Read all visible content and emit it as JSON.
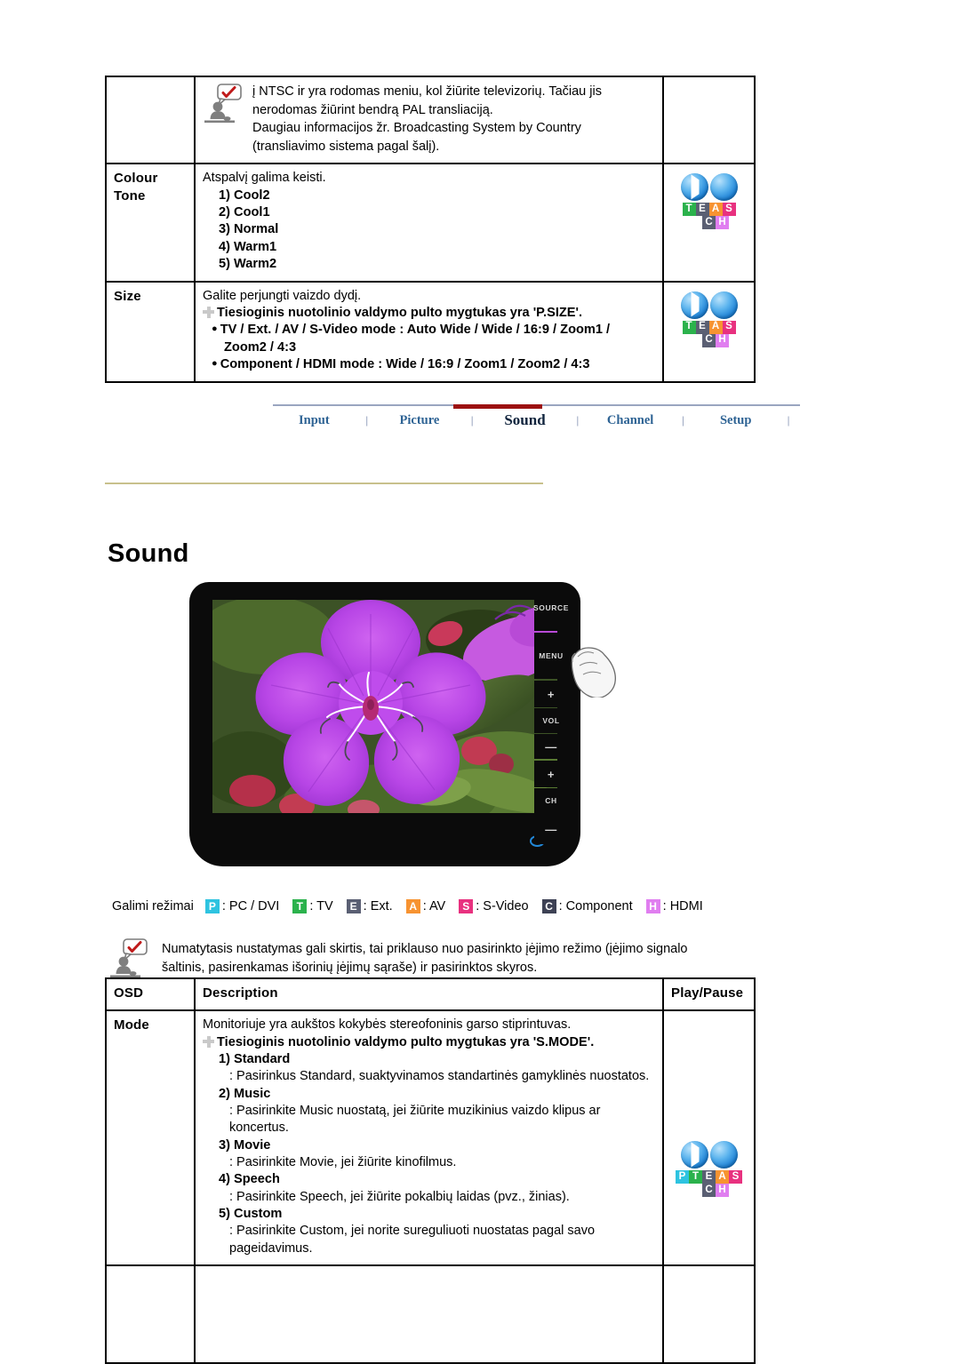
{
  "top_table": {
    "rows": [
      {
        "osd": "",
        "notice": {
          "icon": "notice-person-check-icon",
          "lines": [
            "į NTSC ir yra rodomas meniu, kol žiūrite televizorių. Tačiau jis",
            "nerodomas žiūrint bendrą PAL transliaciją.",
            "Daugiau informacijos žr. Broadcasting System by Country",
            "(transliavimo sistema pagal šalį)."
          ]
        },
        "icons": []
      },
      {
        "osd_lines": [
          "Colour",
          "Tone"
        ],
        "lead": "Atspalvį galima keisti.",
        "options": [
          "1) Cool2",
          "2) Cool1",
          "3) Normal",
          "4) Warm1",
          "5) Warm2"
        ],
        "icon_letters_row1": [
          "T",
          "E",
          "A",
          "S"
        ],
        "icon_letters_row2": [
          "C",
          "H"
        ]
      },
      {
        "osd_lines": [
          "Size"
        ],
        "lead": "Galite perjungti vaizdo dydį.",
        "direct_button": "Tiesioginis nuotolinio valdymo pulto mygtukas yra 'P.SIZE'.",
        "bullets": [
          "TV / Ext. / AV / S-Video mode : Auto Wide / Wide / 16:9 / Zoom1 / Zoom2 / 4:3",
          "Component / HDMI mode : Wide / 16:9 / Zoom1 / Zoom2 / 4:3"
        ],
        "icon_letters_row1": [
          "T",
          "E",
          "A",
          "S"
        ],
        "icon_letters_row2": [
          "C",
          "H"
        ]
      }
    ]
  },
  "nav": {
    "tabs": [
      {
        "label": "Input",
        "active": false
      },
      {
        "label": "Picture",
        "active": false
      },
      {
        "label": "Sound",
        "active": true
      },
      {
        "label": "Channel",
        "active": false
      },
      {
        "label": "Setup",
        "active": false
      }
    ],
    "separator": "|",
    "active_color": "#9c1212",
    "link_color": "#2e6394"
  },
  "page_title": "Sound",
  "tv": {
    "panel_buttons": [
      "SOURCE",
      "MENU",
      "+",
      "VOL",
      "—",
      "+",
      "CH",
      "—"
    ],
    "led_name": "power-led-indicator",
    "screen_content": "purple-tibouchina-flower-photo"
  },
  "legend": {
    "lead": "Galimi režimai",
    "items": [
      {
        "letter": "P",
        "label": ": PC / DVI",
        "color": "#2ec3e0"
      },
      {
        "letter": "T",
        "label": ": TV",
        "color": "#2bb24c"
      },
      {
        "letter": "E",
        "label": ": Ext.",
        "color": "#5a5f73"
      },
      {
        "letter": "A",
        "label": ": AV",
        "color": "#f79331"
      },
      {
        "letter": "S",
        "label": ": S-Video",
        "color": "#e8317f"
      },
      {
        "letter": "C",
        "label": ": Component",
        "color": "#3d4154"
      },
      {
        "letter": "H",
        "label": ": HDMI",
        "color": "#e07ef0"
      }
    ]
  },
  "mid_notice": {
    "icon": "notice-person-check-icon",
    "line1": "Numatytasis nustatymas gali skirtis, tai priklauso nuo pasirinkto įėjimo režimo (įėjimo signalo",
    "line2": "šaltinis, pasirenkamas išorinių įėjimų sąraše) ir pasirinktos skyros."
  },
  "osd_table": {
    "headers": {
      "osd": "OSD",
      "description": "Description",
      "play_pause": "Play/Pause"
    },
    "mode_row": {
      "osd": "Mode",
      "lead": "Monitoriuje yra aukštos kokybės stereofoninis garso stiprintuvas.",
      "direct_button": "Tiesioginis nuotolinio valdymo pulto mygtukas yra 'S.MODE'.",
      "options": [
        {
          "title": "1) Standard",
          "desc": ": Pasirinkus Standard, suaktyvinamos standartinės gamyklinės nuostatos."
        },
        {
          "title": "2) Music",
          "desc": ": Pasirinkite Music nuostatą, jei žiūrite muzikinius vaizdo klipus ar koncertus."
        },
        {
          "title": "3) Movie",
          "desc": ": Pasirinkite Movie, jei žiūrite kinofilmus."
        },
        {
          "title": "4) Speech",
          "desc": ": Pasirinkite Speech, jei žiūrite pokalbių laidas (pvz., žinias)."
        },
        {
          "title": "5) Custom",
          "desc": ": Pasirinkite Custom, jei norite sureguliuoti nuostatas pagal savo pageidavimus."
        }
      ],
      "icon_letters_row1": [
        "P",
        "T",
        "E",
        "A",
        "S"
      ],
      "icon_letters_row2": [
        "C",
        "H"
      ]
    }
  }
}
